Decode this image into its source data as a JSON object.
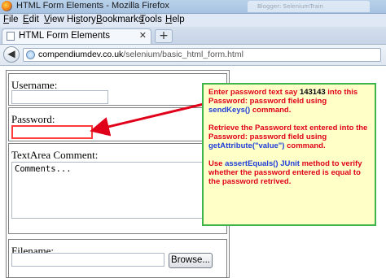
{
  "window": {
    "title": "HTML Form Elements - Mozilla Firefox",
    "background_tab_text": "Blogger: SeleniumTrain"
  },
  "menubar": {
    "items": [
      {
        "mnemonic": "F",
        "rest": "ile"
      },
      {
        "mnemonic": "E",
        "rest": "dit"
      },
      {
        "mnemonic": "V",
        "rest": "iew"
      },
      {
        "mnemonic": "",
        "pre": "Hi",
        "mnemonic2": "s",
        "rest": "tory"
      },
      {
        "mnemonic": "B",
        "rest": "ookmarks"
      },
      {
        "mnemonic": "T",
        "rest": "ools"
      },
      {
        "mnemonic": "H",
        "rest": "elp"
      }
    ]
  },
  "tabs": {
    "active_label": "HTML Form Elements",
    "close_glyph": "✕",
    "new_tab_glyph": "+"
  },
  "navigation": {
    "back_glyph": "◀",
    "url_domain": "compendiumdev.co.uk",
    "url_path": "/selenium/basic_html_form.html"
  },
  "form": {
    "username_label": "Username:",
    "username_value": "",
    "password_label": "Password:",
    "password_value": "",
    "textarea_label": "TextArea Comment:",
    "textarea_value": "Comments...",
    "filename_label": "Filename:",
    "browse_button": "Browse..."
  },
  "annotation": {
    "notes": [
      {
        "parts": [
          {
            "text": "Enter password text say ",
            "style": "red"
          },
          {
            "text": "143143",
            "style": "num"
          },
          {
            "text": " into this Password: password field using ",
            "style": "red"
          },
          {
            "text": "sendKeys()",
            "style": "code"
          },
          {
            "text": " command.",
            "style": "red"
          }
        ]
      },
      {
        "parts": [
          {
            "text": "Retrieve the Password text entered into the Password: password field using ",
            "style": "red"
          },
          {
            "text": "getAttribute(\"value\")",
            "style": "code"
          },
          {
            "text": " command.",
            "style": "red"
          }
        ]
      },
      {
        "parts": [
          {
            "text": "Use ",
            "style": "red"
          },
          {
            "text": "assertEquals() JUnit",
            "style": "code"
          },
          {
            "text": " method to verify whether the password entered is equal to the password retrived.",
            "style": "red"
          }
        ]
      }
    ]
  },
  "colors": {
    "annotation_red": "#e0001a",
    "annotation_blue": "#1f3fd8",
    "callout_fill": "#ffffc8",
    "callout_border": "#3fb44a",
    "highlight_border": "#ff3b3b"
  }
}
